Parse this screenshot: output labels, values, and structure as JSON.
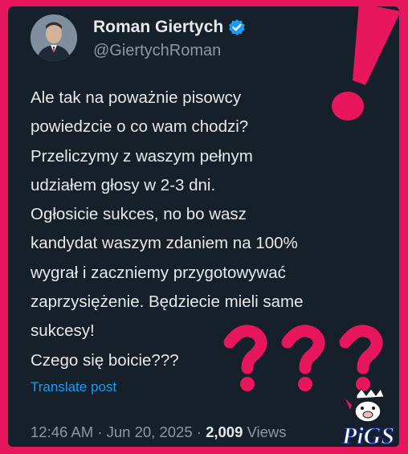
{
  "post": {
    "author_name": "Roman Giertych",
    "handle": "@GiertychRoman",
    "body_lines": [
      "Ale tak na poważnie pisowcy",
      "powiedzcie o co wam chodzi?",
      "Przeliczymy z waszym pełnym",
      "udziałem głosy w 2-3 dni.",
      "Ogłosicie sukces, no bo wasz",
      "kandydat waszym zdaniem na 100%",
      "wygrał i zaczniemy przygotowywać",
      "zaprzysiężenie. Będziecie mieli same",
      "sukcesy!",
      "Czego się boicie???"
    ],
    "translate_label": "Translate post",
    "time": "12:46 AM",
    "date": "Jun 20, 2025",
    "views_count": "2,009",
    "views_label": "Views"
  },
  "overlay": {
    "watermark_text": "PiGS",
    "exclamation_color": "#e8175d",
    "question_color": "#e8175d"
  },
  "icons": {
    "verified": "verified-badge-icon"
  }
}
